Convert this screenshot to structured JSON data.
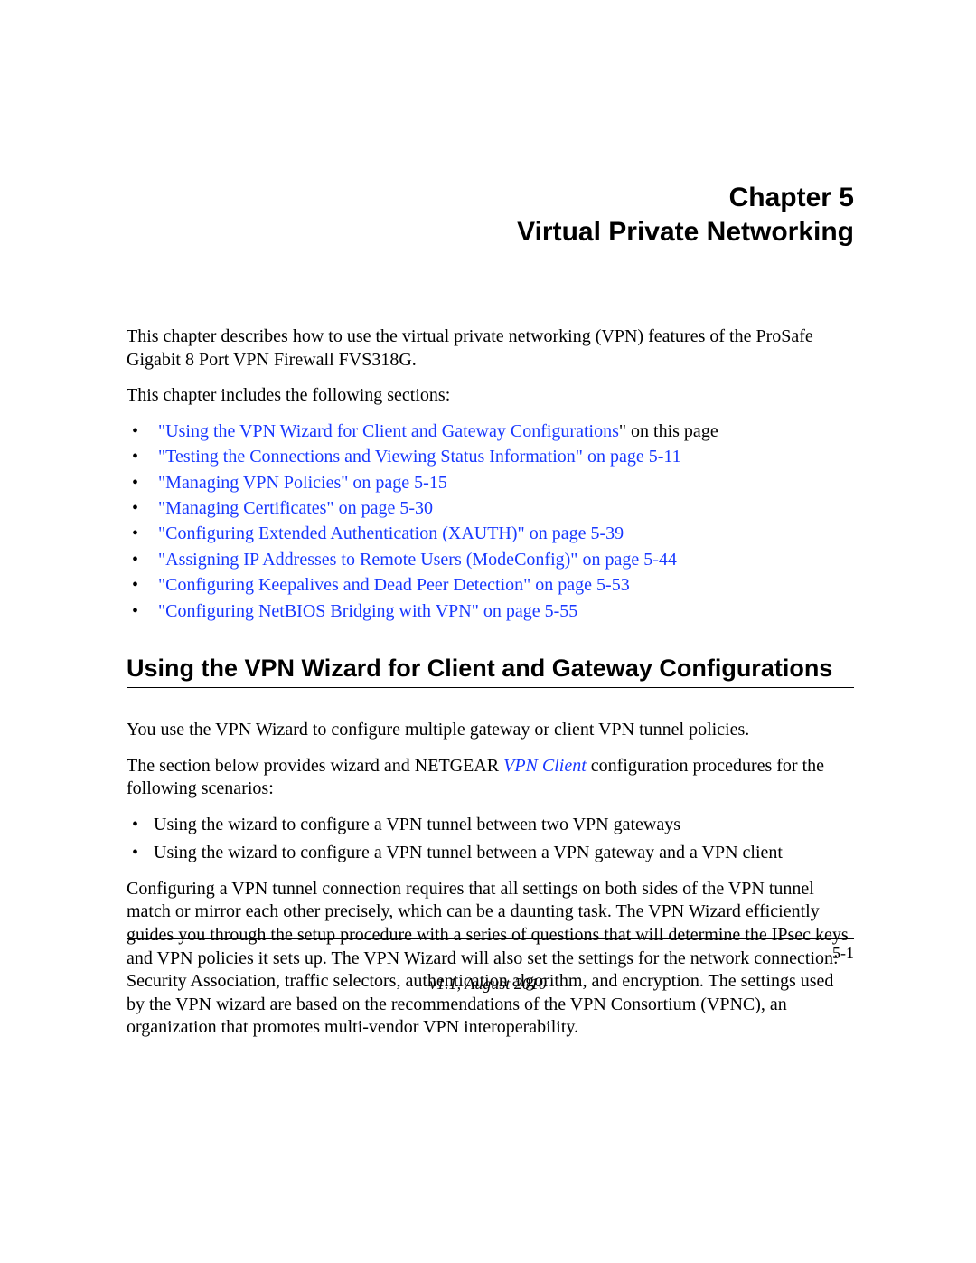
{
  "chapter": {
    "line1": "Chapter 5",
    "line2": "Virtual Private Networking"
  },
  "intro": {
    "p1": "This chapter describes how to use the virtual private networking (VPN) features of the ProSafe Gigabit 8 Port VPN Firewall FVS318G.",
    "p2": "This chapter includes the following sections:"
  },
  "toc": [
    {
      "link": "\"Using the VPN Wizard for Client and Gateway Configurations",
      "suffix": "\" on this page"
    },
    {
      "link": "\"Testing the Connections and Viewing Status Information\" on page 5-11",
      "suffix": ""
    },
    {
      "link": "\"Managing VPN Policies\" on page 5-15",
      "suffix": ""
    },
    {
      "link": "\"Managing Certificates\" on page 5-30",
      "suffix": ""
    },
    {
      "link": "\"Configuring Extended Authentication (XAUTH)\" on page 5-39",
      "suffix": ""
    },
    {
      "link": "\"Assigning IP Addresses to Remote Users (ModeConfig)\" on page 5-44",
      "suffix": ""
    },
    {
      "link": "\"Configuring Keepalives and Dead Peer Detection\" on page 5-53",
      "suffix": ""
    },
    {
      "link": "\"Configuring NetBIOS Bridging with VPN\" on page 5-55",
      "suffix": ""
    }
  ],
  "section": {
    "heading": "Using the VPN Wizard for Client and Gateway Configurations",
    "p1": "You use the VPN Wizard to configure multiple gateway or client VPN tunnel policies.",
    "p2_prefix": "The section below provides wizard and NETGEAR ",
    "p2_link": "VPN Client",
    "p2_suffix": " configuration procedures for the following scenarios:",
    "bullets": [
      "Using the wizard to configure a VPN tunnel between two VPN gateways",
      "Using the wizard to configure a VPN tunnel between a VPN gateway and a VPN client"
    ],
    "p3": "Configuring a VPN tunnel connection requires that all settings on both sides of the VPN tunnel match or mirror each other precisely, which can be a daunting task. The VPN Wizard efficiently guides you through the setup procedure with a series of questions that will determine the IPsec keys and VPN policies it sets up. The VPN Wizard will also set the settings for the network connection: Security Association, traffic selectors, authentication algorithm, and encryption. The settings used by the VPN wizard are based on the recommendations of the VPN Consortium (VPNC), an organization that promotes multi-vendor VPN interoperability."
  },
  "footer": {
    "page_number": "5-1",
    "version": "v1.1, August 2010"
  }
}
